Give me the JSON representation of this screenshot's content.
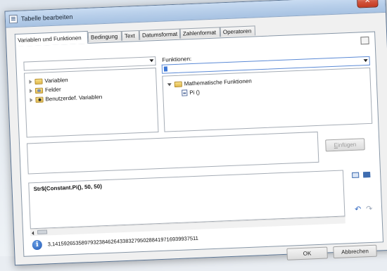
{
  "window": {
    "title": "Tabelle bearbeiten",
    "close_label": "✕"
  },
  "tabs": [
    {
      "label": "Variablen und Funktionen",
      "active": true
    },
    {
      "label": "Bedingung",
      "active": false
    },
    {
      "label": "Text",
      "active": false
    },
    {
      "label": "Datumsformat",
      "active": false
    },
    {
      "label": "Zahlenformat",
      "active": false
    },
    {
      "label": "Operatoren",
      "active": false
    }
  ],
  "left": {
    "combo_value": "",
    "tree": [
      {
        "label": "Variablen",
        "icon": "folder-icon"
      },
      {
        "label": "Felder",
        "icon": "database-folder-icon"
      },
      {
        "label": "Benutzerdef. Variablen",
        "icon": "user-folder-icon"
      }
    ]
  },
  "right": {
    "functions_label": "Funktionen:",
    "combo_value": "",
    "tree_root": "Mathematische Funktionen",
    "tree_child": "Pi ()"
  },
  "insert_button": {
    "label_prefix": "",
    "label_accel": "E",
    "label_rest": "infügen"
  },
  "expression": "Str$(Constant.Pi(), 50, 50)",
  "result": "3,14159265358979323846264338327950288419716939937511",
  "footer": {
    "ok_label": "OK",
    "cancel_label": "Abbrechen"
  },
  "colors": {
    "titlebar": "#b8cfea",
    "close": "#c43b22",
    "accent": "#3b5a86"
  }
}
